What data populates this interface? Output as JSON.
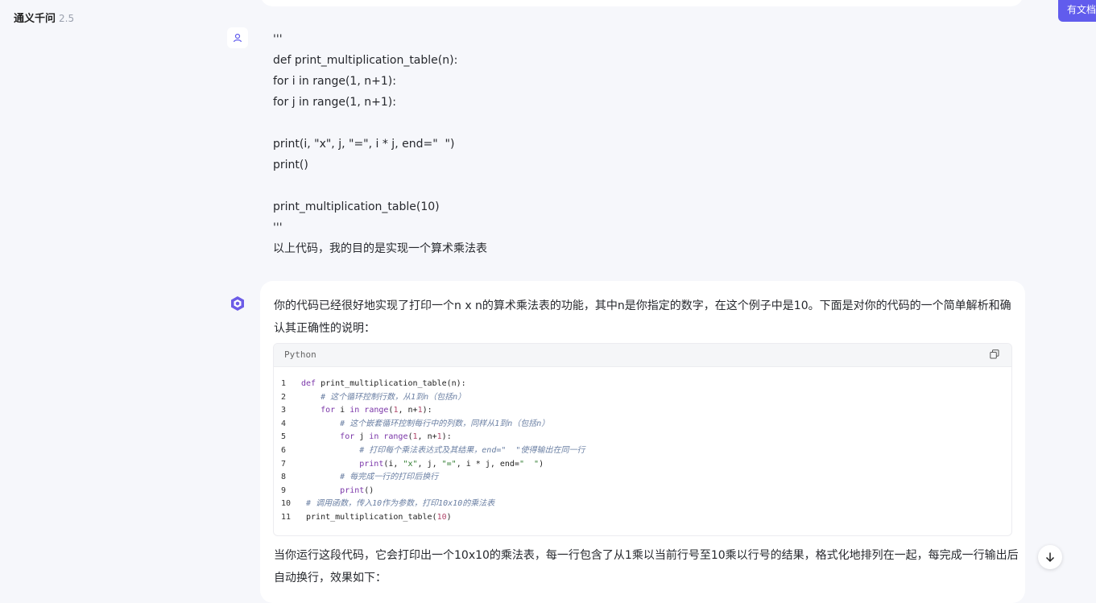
{
  "app": {
    "name": "通义千问",
    "version": "2.5"
  },
  "doc_button": "有文档",
  "user_message": {
    "lines": [
      "'''",
      "def print_multiplication_table(n):",
      "for i in range(1, n+1):",
      "for j in range(1, n+1):",
      "",
      "print(i, \"x\", j, \"=\", i * j, end=\"  \")",
      "print()",
      "",
      "print_multiplication_table(10)",
      "'''",
      "以上代码，我的目的是实现一个算术乘法表"
    ]
  },
  "bot_message": {
    "intro": "你的代码已经很好地实现了打印一个n x n的算术乘法表的功能，其中n是你指定的数字，在这个例子中是10。下面是对你的代码的一个简单解析和确认其正确性的说明：",
    "code": {
      "language": "Python",
      "lines": [
        {
          "num": "1",
          "text": "def print_multiplication_table(n):"
        },
        {
          "num": "2",
          "text": "    # 这个循环控制行数，从1到n（包括n）"
        },
        {
          "num": "3",
          "text": "    for i in range(1, n+1):"
        },
        {
          "num": "4",
          "text": "        # 这个嵌套循环控制每行中的列数，同样从1到n（包括n）"
        },
        {
          "num": "5",
          "text": "        for j in range(1, n+1):"
        },
        {
          "num": "6",
          "text": "            # 打印每个乘法表达式及其结果，end=\"  \"使得输出在同一行"
        },
        {
          "num": "7",
          "text": "            print(i, \"x\", j, \"=\", i * j, end=\"  \")"
        },
        {
          "num": "8",
          "text": "        # 每完成一行的打印后换行"
        },
        {
          "num": "9",
          "text": "        print()"
        },
        {
          "num": "10",
          "text": " # 调用函数，传入10作为参数，打印10x10的乘法表"
        },
        {
          "num": "11",
          "text": " print_multiplication_table(10)"
        }
      ]
    },
    "after": "当你运行这段代码，它会打印出一个10x10的乘法表，每一行包含了从1乘以当前行号至10乘以行号的结果，格式化地排列在一起，每完成一行输出后自动换行，效果如下："
  },
  "icons": {
    "user_avatar": "user-icon",
    "bot_avatar": "qwen-logo-icon",
    "copy": "copy-icon",
    "scroll_down": "arrow-down-icon"
  },
  "colors": {
    "accent": "#615ced",
    "background": "#f6f7fb"
  }
}
